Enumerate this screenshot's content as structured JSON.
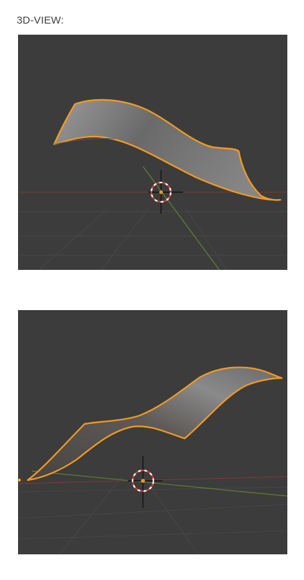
{
  "section": {
    "title": "3D-VIEW:"
  },
  "viewports": [
    {
      "name": "viewport-top",
      "object": "curved-surface",
      "selection_color": "#f59a23"
    },
    {
      "name": "viewport-bottom",
      "object": "curved-surface",
      "selection_color": "#f59a23"
    }
  ],
  "colors": {
    "background": "#3c3c3c",
    "grid": "#4a4a4a",
    "x_axis": "#8a3a3a",
    "y_axis": "#5f7f32",
    "selection_outline": "#f59a23",
    "cursor_ring_red": "#d43b3b",
    "cursor_ring_white": "#ffffff"
  },
  "icons": [
    "3d-cursor-icon",
    "origin-point-icon"
  ]
}
